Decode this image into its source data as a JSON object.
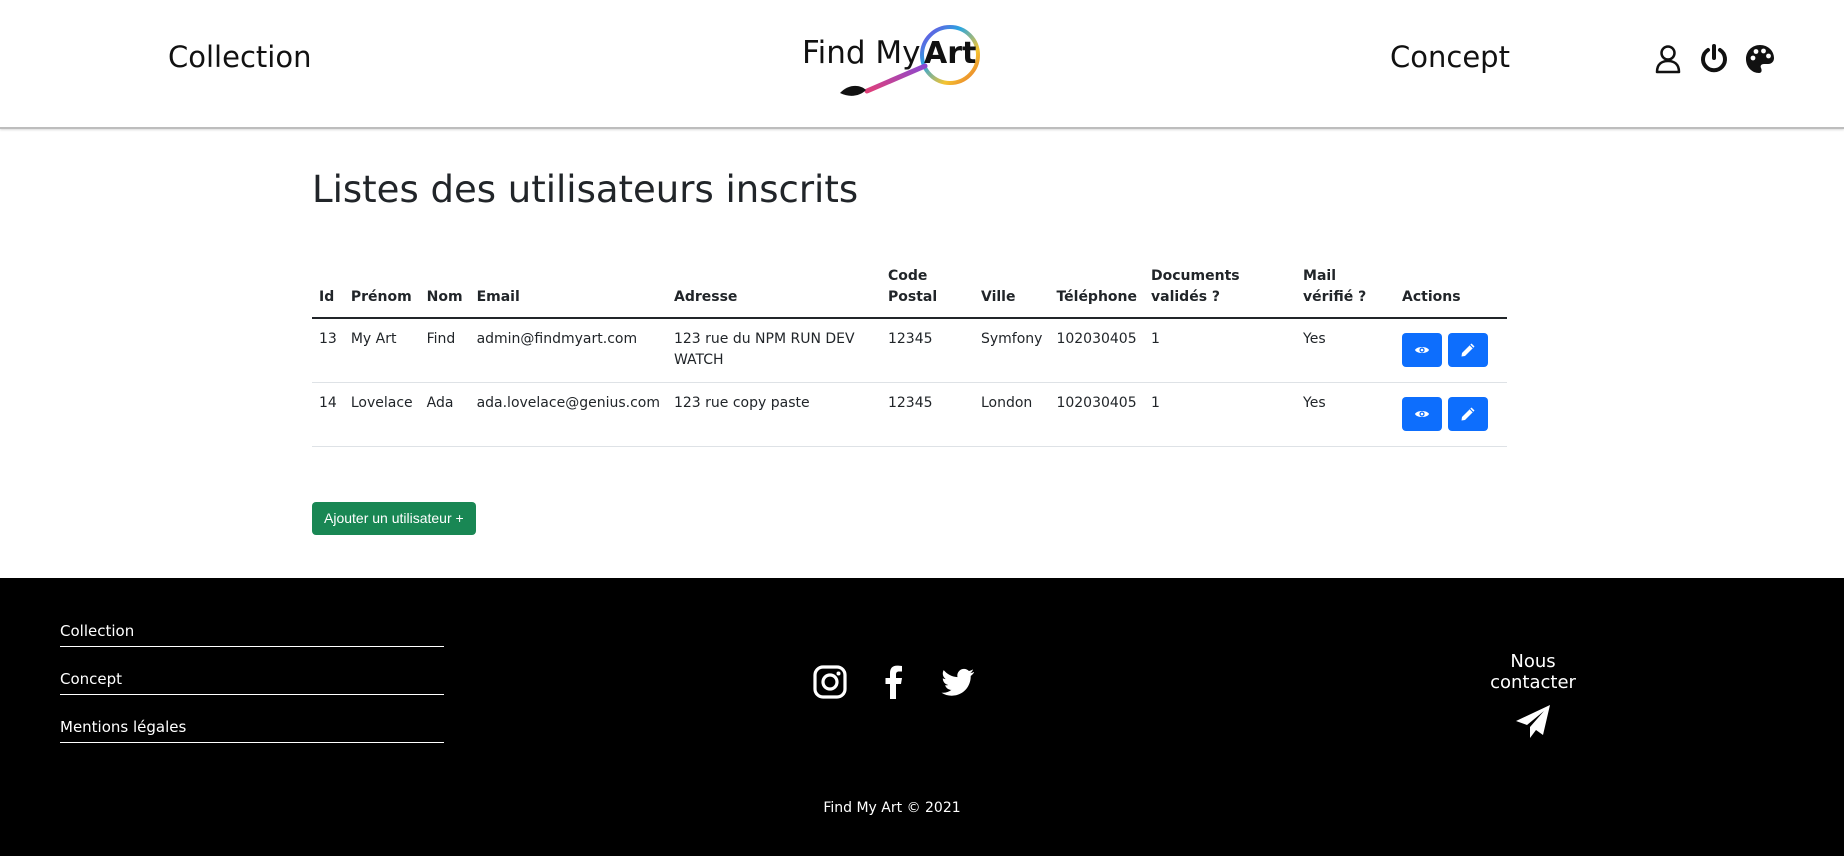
{
  "header": {
    "nav_collection": "Collection",
    "nav_concept": "Concept",
    "logo_text": "Find My",
    "logo_art": "Art",
    "icons": [
      "user-icon",
      "power-icon",
      "palette-icon"
    ]
  },
  "main": {
    "title": "Listes des utilisateurs inscrits",
    "table": {
      "headers": [
        "Id",
        "Prénom",
        "Nom",
        "Email",
        "Adresse",
        "Code Postal",
        "Ville",
        "Téléphone",
        "Documents validés ?",
        "Mail vérifié ?",
        "Actions"
      ],
      "rows": [
        {
          "id": "13",
          "prenom": "My Art",
          "nom": "Find",
          "email": "admin@findmyart.com",
          "adresse": "123 rue du NPM RUN DEV WATCH",
          "code_postal": "12345",
          "ville": "Symfony",
          "telephone": "102030405",
          "documents": "1",
          "mail_verifie": "Yes"
        },
        {
          "id": "14",
          "prenom": "Lovelace",
          "nom": "Ada",
          "email": "ada.lovelace@genius.com",
          "adresse": "123 rue copy paste",
          "code_postal": "12345",
          "ville": "London",
          "telephone": "102030405",
          "documents": "1",
          "mail_verifie": "Yes"
        }
      ]
    },
    "add_button": "Ajouter un utilisateur +"
  },
  "footer": {
    "links": [
      "Collection",
      "Concept",
      "Mentions légales"
    ],
    "social_icons": [
      "instagram-icon",
      "facebook-icon",
      "twitter-icon"
    ],
    "contact_label": "Nous contacter",
    "copyright": "Find My Art © 2021"
  },
  "colors": {
    "primary_button": "#0d6efd",
    "success_button": "#198754",
    "footer_bg": "#000000"
  }
}
